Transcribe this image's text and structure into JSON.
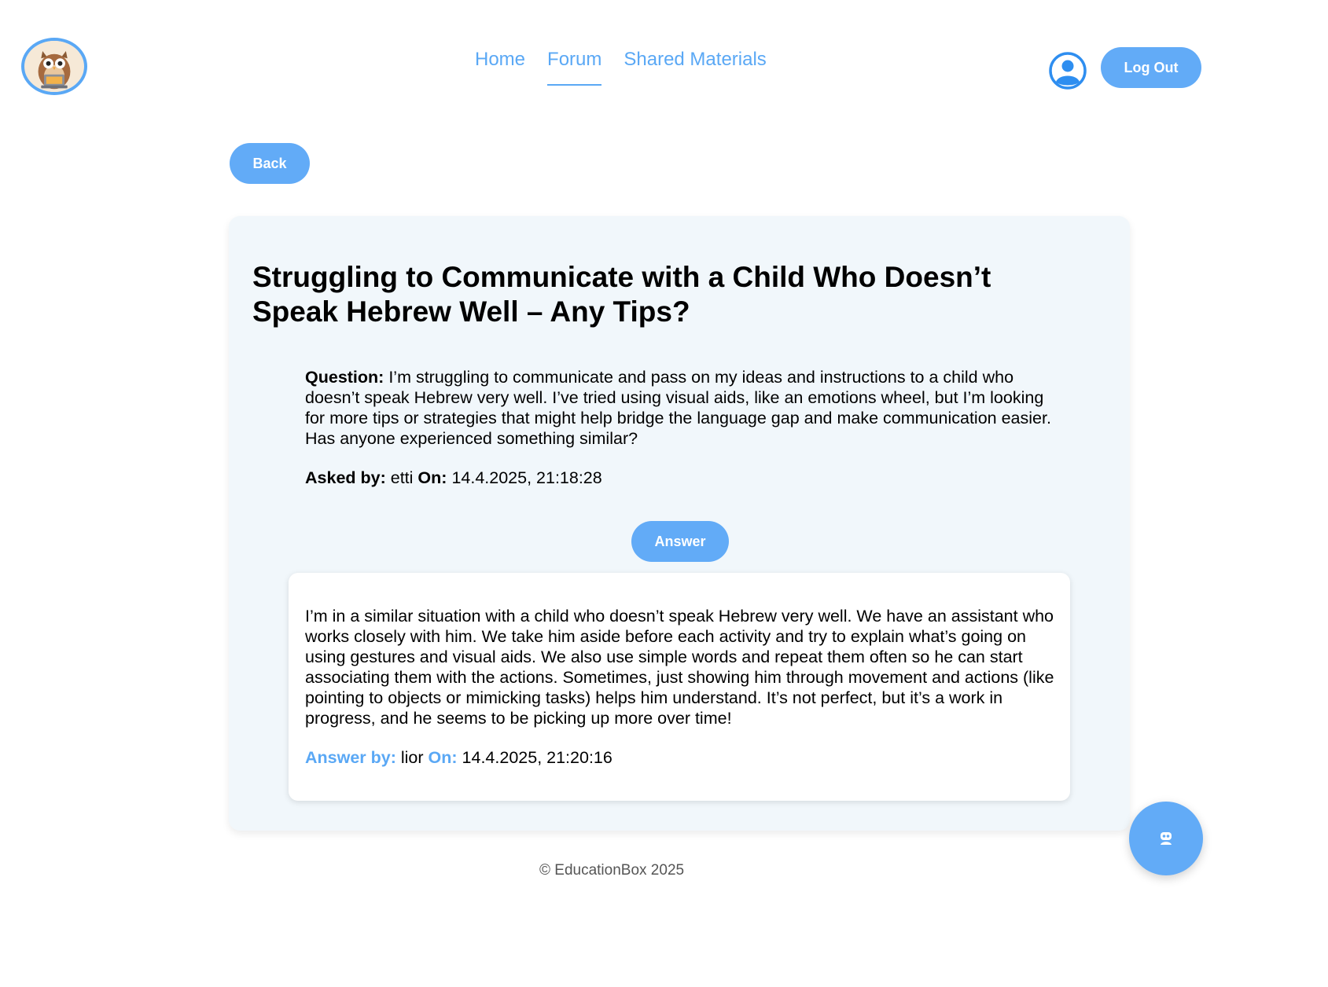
{
  "header": {
    "nav": [
      {
        "label": "Home"
      },
      {
        "label": "Forum",
        "active": true
      },
      {
        "label": "Shared Materials"
      }
    ],
    "logout_label": "Log Out"
  },
  "back_label": "Back",
  "post": {
    "title": "Struggling to Communicate with a Child Who Doesn’t Speak Hebrew Well – Any Tips?",
    "question_label": "Question:",
    "question_text": "I’m struggling to communicate and pass on my ideas and instructions to a child who doesn’t speak Hebrew very well. I’ve tried using visual aids, like an emotions wheel, but I’m looking for more tips or strategies that might help bridge the language gap and make communication easier. Has anyone experienced something similar?",
    "asked_by_label": "Asked by:",
    "asked_by": "etti",
    "on_label": "On:",
    "asked_on": "14.4.2025, 21:18:28",
    "answer_button_label": "Answer"
  },
  "answers": [
    {
      "text": "I’m in a similar situation with a child who doesn’t speak Hebrew very well. We have an assistant who works closely with him. We take him aside before each activity and try to explain what’s going on using gestures and visual aids. We also use simple words and repeat them often so he can start associating them with the actions. Sometimes, just showing him through movement and actions (like pointing to objects or mimicking tasks) helps him understand. It’s not perfect, but it’s a work in progress, and he seems to be picking up more over time!",
      "by_label": "Answer by:",
      "by": "lior",
      "on_label": "On:",
      "on": "14.4.2025, 21:20:16"
    }
  ],
  "footer": "© EducationBox 2025",
  "colors": {
    "accent": "#5aa8f5",
    "button": "#62abf7",
    "card_bg": "#f1f7fb"
  },
  "icons": {
    "logo": "owl-logo-icon",
    "profile": "user-circle-icon",
    "chat": "robot-icon"
  }
}
